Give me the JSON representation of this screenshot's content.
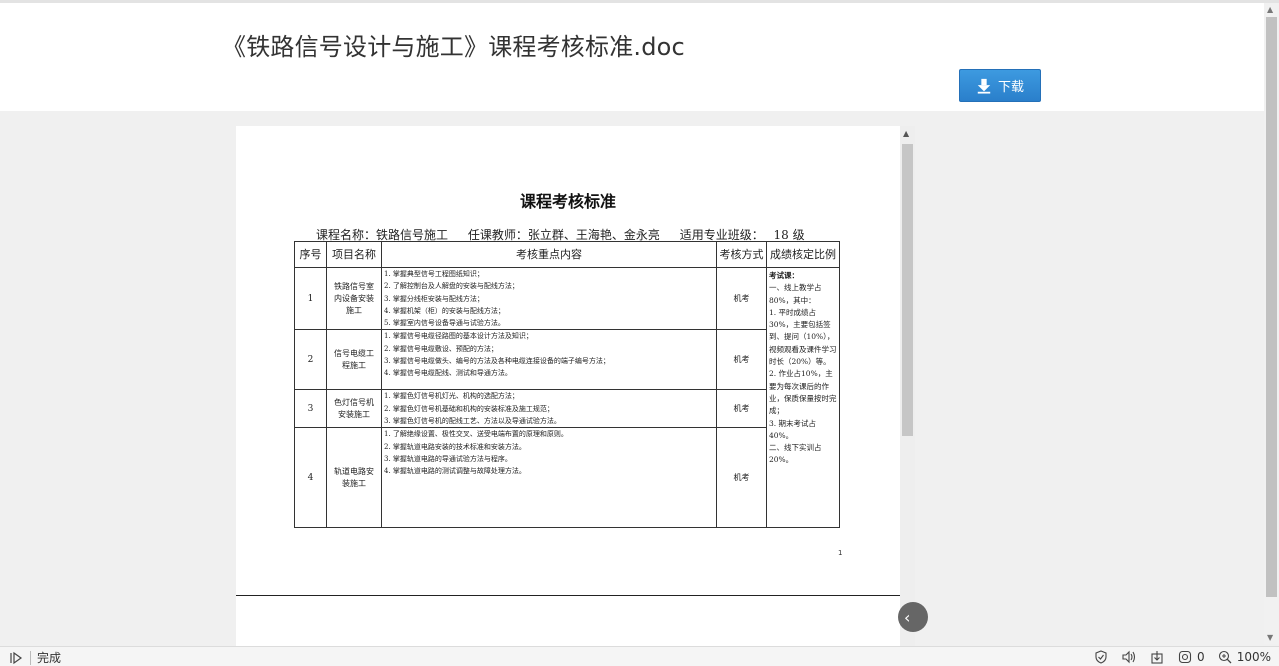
{
  "page": {
    "title": "《铁路信号设计与施工》课程考核标准.doc",
    "download_label": "下载"
  },
  "document": {
    "heading": "课程考核标准",
    "course_info": {
      "course_name": "课程名称：铁路信号施工",
      "teachers": "任课教师：张立群、王海艳、金永亮",
      "class": "适用专业班级：",
      "grade": "18 级"
    },
    "table": {
      "headers": [
        "序号",
        "项目名称",
        "考核重点内容",
        "考核方式",
        "成绩核定比例"
      ],
      "rows": [
        {
          "no": "1",
          "name": "铁路信号室内设备安装施工",
          "content": [
            "1. 掌握典型信号工程图纸知识；",
            "2. 了解控制台及人解盘的安装与配线方法；",
            "3. 掌握分线柜安装与配线方法；",
            "4. 掌握机架（柜）的安装与配线方法；",
            "5. 掌握室内信号设备导通与试验方法。"
          ],
          "method": "机考"
        },
        {
          "no": "2",
          "name": "信号电缆工程施工",
          "content": [
            "1. 掌握信号电缆径路图的基本设计方法及知识；",
            "2. 掌握信号电缆敷设、预配的方法；",
            "3. 掌握信号电缆做头、编号的方法及各种电缆连接设备的端子编号方法；",
            "4. 掌握信号电缆配线、测试和导通方法。"
          ],
          "method": "机考"
        },
        {
          "no": "3",
          "name": "色灯信号机安装施工",
          "content": [
            "1. 掌握色灯信号机灯光、机构的选配方法；",
            "2. 掌握色灯信号机基础和机构的安装标准及施工规范；",
            "3. 掌握色灯信号机的配线工艺、方法以及导通试验方法。"
          ],
          "method": "机考"
        },
        {
          "no": "4",
          "name": "轨道电路安装施工",
          "content": [
            "1. 了解绝缘设置、极性交叉、送受电端布置的原理和原则。",
            "2. 掌握轨道电路安装的技术标准和安装方法。",
            "3. 掌握轨道电路的导通试验方法与程序。",
            "4. 掌握轨道电路的测试调整与故障处理方法。"
          ],
          "method": "机考"
        }
      ],
      "ratio": {
        "title": "考试课：",
        "lines": [
          "一、线上教学占80%，其中：",
          "1. 平时成绩占30%，主要包括签到、提问（10%），视频观看及课件学习时长（20%）等。",
          "2. 作业占10%，主要为每次课后的作业，保质保量按时完成；",
          "3. 期末考试占40%。",
          "二、线下实训占20%。"
        ]
      }
    },
    "page_number": "1"
  },
  "statusbar": {
    "status": "完成",
    "privacy_count": "0",
    "zoom": "100%"
  }
}
